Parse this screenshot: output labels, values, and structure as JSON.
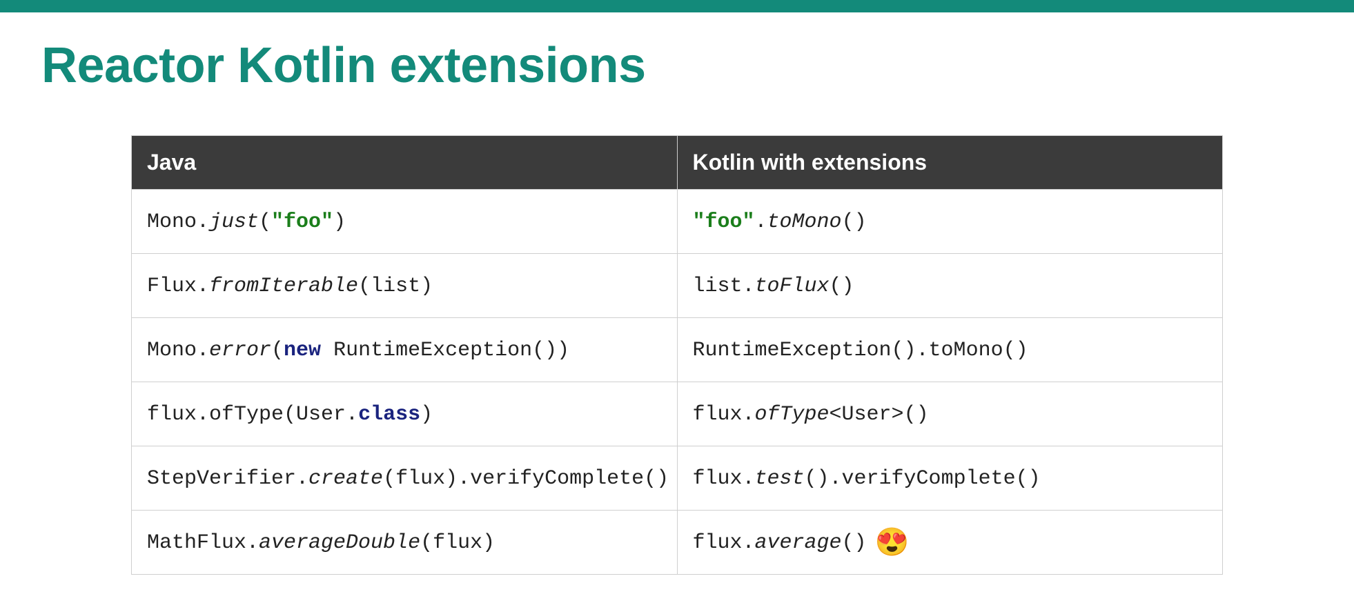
{
  "title": "Reactor Kotlin extensions",
  "headers": {
    "java": "Java",
    "kotlin": "Kotlin with extensions"
  },
  "rows": [
    {
      "java": [
        {
          "t": "Mono."
        },
        {
          "t": "just",
          "cls": "em"
        },
        {
          "t": "("
        },
        {
          "t": "\"foo\"",
          "cls": "str"
        },
        {
          "t": ")"
        }
      ],
      "kotlin": [
        {
          "t": "\"foo\"",
          "cls": "str"
        },
        {
          "t": "."
        },
        {
          "t": "toMono",
          "cls": "em"
        },
        {
          "t": "()"
        }
      ]
    },
    {
      "java": [
        {
          "t": "Flux."
        },
        {
          "t": "fromIterable",
          "cls": "em"
        },
        {
          "t": "(list)"
        }
      ],
      "kotlin": [
        {
          "t": "list."
        },
        {
          "t": "toFlux",
          "cls": "em"
        },
        {
          "t": "()"
        }
      ]
    },
    {
      "java": [
        {
          "t": "Mono."
        },
        {
          "t": "error",
          "cls": "em"
        },
        {
          "t": "("
        },
        {
          "t": "new ",
          "cls": "kw"
        },
        {
          "t": "RuntimeException())"
        }
      ],
      "kotlin": [
        {
          "t": "RuntimeException().toMono()"
        }
      ]
    },
    {
      "tall": true,
      "java": [
        {
          "t": "flux.ofType(User."
        },
        {
          "t": "class",
          "cls": "kw"
        },
        {
          "t": ")"
        }
      ],
      "kotlin": [
        {
          "t": "flux."
        },
        {
          "t": "ofType",
          "cls": "em"
        },
        {
          "t": "<User>()"
        }
      ]
    },
    {
      "java": [
        {
          "t": "StepVerifier."
        },
        {
          "t": "create",
          "cls": "em"
        },
        {
          "t": "(flux).verifyComplete()"
        }
      ],
      "kotlin": [
        {
          "t": "flux."
        },
        {
          "t": "test",
          "cls": "em"
        },
        {
          "t": "().verifyComplete()"
        }
      ]
    },
    {
      "java": [
        {
          "t": "MathFlux."
        },
        {
          "t": "averageDouble",
          "cls": "em"
        },
        {
          "t": "(flux)"
        }
      ],
      "kotlin": [
        {
          "t": "flux."
        },
        {
          "t": "average",
          "cls": "em"
        },
        {
          "t": "()"
        }
      ],
      "kotlin_emoji": "😍"
    }
  ]
}
